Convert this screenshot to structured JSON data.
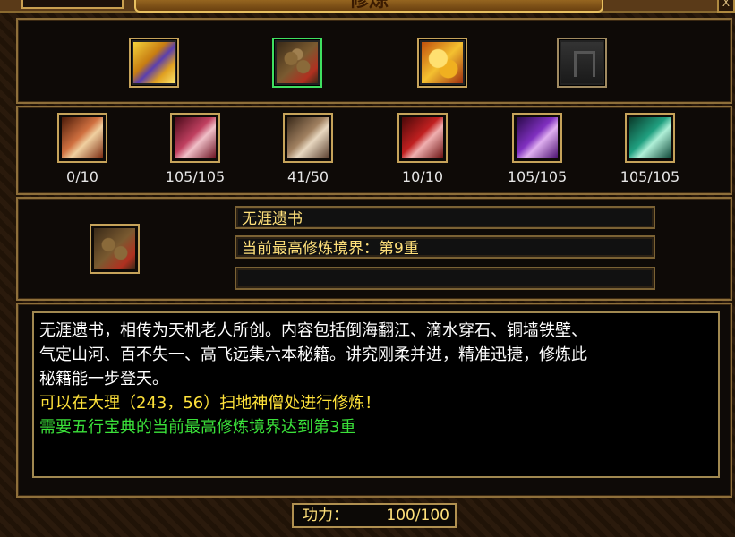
{
  "window": {
    "title": "修炼",
    "close_label": "X"
  },
  "books": [
    {
      "icon": "golden-book-icon",
      "selected": false
    },
    {
      "icon": "scroll-bundle-icon",
      "selected": true
    },
    {
      "icon": "gold-treasure-icon",
      "selected": false
    },
    {
      "icon": "locked-slot-icon",
      "selected": false
    }
  ],
  "skills": [
    {
      "icon": "scroll-orange-icon",
      "count": "0/10"
    },
    {
      "icon": "scroll-pink-icon",
      "count": "105/105"
    },
    {
      "icon": "scroll-tan-icon",
      "count": "41/50"
    },
    {
      "icon": "scroll-red-icon",
      "count": "10/10"
    },
    {
      "icon": "scroll-purple-icon",
      "count": "105/105"
    },
    {
      "icon": "scroll-teal-icon",
      "count": "105/105"
    }
  ],
  "selected": {
    "name": "无涯遗书",
    "realm": "当前最高修炼境界：第9重",
    "extra": ""
  },
  "description": {
    "line1": "无涯遗书，相传为天机老人所创。内容包括倒海翻江、滴水穿石、铜墙铁壁、",
    "line2": "气定山河、百不失一、高飞远集六本秘籍。讲究刚柔并进，精准迅捷，修炼此",
    "line3": "秘籍能一步登天。",
    "location": "可以在大理（243，56）扫地神僧处进行修炼！",
    "requirement": "需要五行宝典的当前最高修炼境界达到第3重"
  },
  "power": {
    "label": "功力：",
    "value": "100/100"
  },
  "colors": {
    "border": "#8e6f3a",
    "yellow": "#ffe23a",
    "green": "#3be23a"
  }
}
